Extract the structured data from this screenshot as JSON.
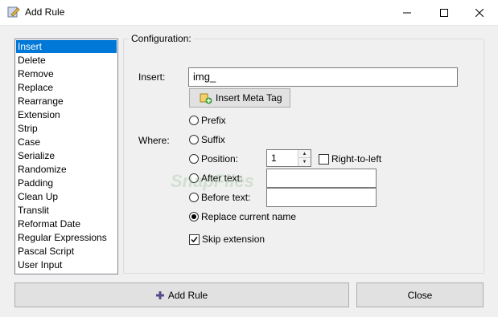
{
  "window": {
    "title": "Add Rule",
    "accent": "#0078d7"
  },
  "rules": {
    "items": [
      "Insert",
      "Delete",
      "Remove",
      "Replace",
      "Rearrange",
      "Extension",
      "Strip",
      "Case",
      "Serialize",
      "Randomize",
      "Padding",
      "Clean Up",
      "Translit",
      "Reformat Date",
      "Regular Expressions",
      "Pascal Script",
      "User Input"
    ],
    "selected": "Insert"
  },
  "config": {
    "group_label": "Configuration:",
    "insert_label": "Insert:",
    "insert_value": "img_",
    "meta_button": "Insert Meta Tag",
    "where_label": "Where:",
    "prefix": "Prefix",
    "suffix": "Suffix",
    "position": "Position:",
    "position_value": "1",
    "right_to_left": "Right-to-left",
    "after_text": "After text:",
    "before_text": "Before text:",
    "replace_current": "Replace current name",
    "skip_extension": "Skip extension",
    "selected_where": "Replace current name",
    "skip_extension_checked": true,
    "right_to_left_checked": false
  },
  "buttons": {
    "add_rule": "Add Rule",
    "close": "Close"
  },
  "watermark": "SnapFiles"
}
